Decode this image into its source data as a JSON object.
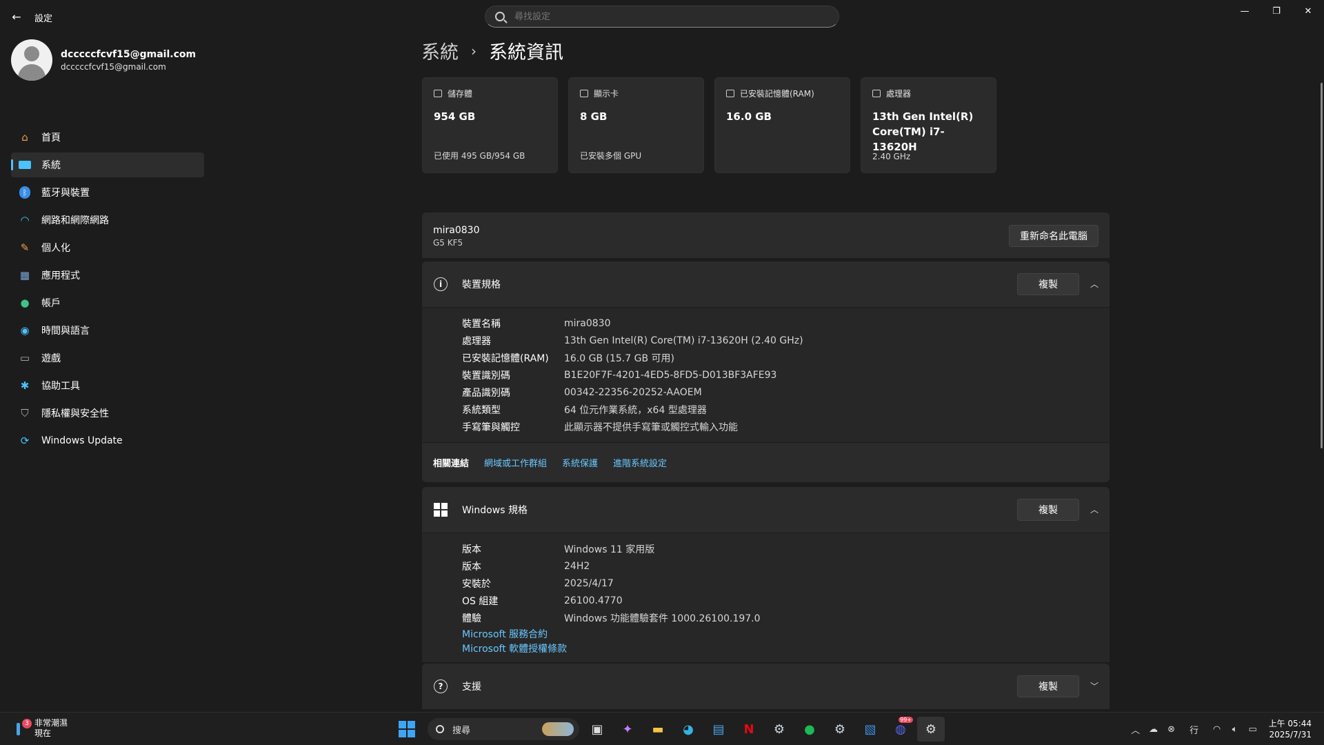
{
  "window": {
    "back_icon": "back-arrow-icon",
    "title": "設定",
    "search_placeholder": "尋找設定",
    "controls": [
      "minimize-icon",
      "restore-icon",
      "close-icon"
    ]
  },
  "profile": {
    "name": "dcccccfcvf15@gmail.com",
    "email": "dcccccfcvf15@gmail.com"
  },
  "sidebar": {
    "items": [
      {
        "label": "首頁",
        "icon": "home-icon",
        "active": false,
        "color": "#f0a050"
      },
      {
        "label": "系統",
        "icon": "system-icon",
        "active": true,
        "color": "#4cc2ff"
      },
      {
        "label": "藍牙與裝置",
        "icon": "bluetooth-icon",
        "active": false,
        "color": "#3a8ee6"
      },
      {
        "label": "網路和網際網路",
        "icon": "wifi-icon",
        "active": false,
        "color": "#4cc2ff"
      },
      {
        "label": "個人化",
        "icon": "brush-icon",
        "active": false,
        "color": "#f0a050"
      },
      {
        "label": "應用程式",
        "icon": "apps-icon",
        "active": false,
        "color": "#7aa8d8"
      },
      {
        "label": "帳戶",
        "icon": "account-icon",
        "active": false,
        "color": "#3fc28a"
      },
      {
        "label": "時間與語言",
        "icon": "globe-icon",
        "active": false,
        "color": "#4cc2ff"
      },
      {
        "label": "遊戲",
        "icon": "gamepad-icon",
        "active": false,
        "color": "#a0a0a0"
      },
      {
        "label": "協助工具",
        "icon": "accessibility-icon",
        "active": false,
        "color": "#4cc2ff"
      },
      {
        "label": "隱私權與安全性",
        "icon": "shield-icon",
        "active": false,
        "color": "#a0a0a0"
      },
      {
        "label": "Windows Update",
        "icon": "update-icon",
        "active": false,
        "color": "#4cc2ff"
      }
    ]
  },
  "breadcrumb": {
    "parent": "系統",
    "separator": "›",
    "current": "系統資訊"
  },
  "cards": [
    {
      "label": "儲存體",
      "value": "954 GB",
      "sub": "已使用 495 GB/954 GB",
      "icon": "storage-icon"
    },
    {
      "label": "顯示卡",
      "value": "8 GB",
      "sub": "已安裝多個 GPU",
      "icon": "gpu-icon"
    },
    {
      "label": "已安裝記憶體(RAM)",
      "value": "16.0 GB",
      "sub": "",
      "icon": "ram-icon"
    },
    {
      "label": "處理器",
      "value": "13th Gen Intel(R) Core(TM) i7-13620H",
      "sub": "2.40 GHz",
      "icon": "cpu-icon"
    }
  ],
  "pc": {
    "name": "mira0830",
    "model": "G5 KF5",
    "rename_label": "重新命名此電腦"
  },
  "device_specs": {
    "title": "裝置規格",
    "copy_label": "複製",
    "rows": [
      {
        "k": "裝置名稱",
        "v": "mira0830"
      },
      {
        "k": "處理器",
        "v": "13th Gen Intel(R) Core(TM) i7-13620H (2.40 GHz)"
      },
      {
        "k": "已安裝記憶體(RAM)",
        "v": "16.0 GB (15.7 GB 可用)"
      },
      {
        "k": "裝置識別碼",
        "v": "B1E20F7F-4201-4ED5-8FD5-D013BF3AFE93"
      },
      {
        "k": "產品識別碼",
        "v": "00342-22356-20252-AAOEM"
      },
      {
        "k": "系統類型",
        "v": "64 位元作業系統，x64 型處理器"
      },
      {
        "k": "手寫筆與觸控",
        "v": "此顯示器不提供手寫筆或觸控式輸入功能"
      }
    ],
    "related_label": "相關連結",
    "related_links": [
      "網域或工作群組",
      "系統保護",
      "進階系統設定"
    ]
  },
  "windows_specs": {
    "title": "Windows 規格",
    "copy_label": "複製",
    "rows": [
      {
        "k": "版本",
        "v": "Windows 11 家用版"
      },
      {
        "k": "版本",
        "v": "24H2"
      },
      {
        "k": "安裝於",
        "v": "2025/4/17"
      },
      {
        "k": "OS 組建",
        "v": "26100.4770"
      },
      {
        "k": "體驗",
        "v": "Windows 功能體驗套件 1000.26100.197.0"
      }
    ],
    "links": [
      "Microsoft 服務合約",
      "Microsoft 軟體授權條款"
    ]
  },
  "support": {
    "title": "支援",
    "copy_label": "複製"
  },
  "taskbar": {
    "weather_badge": "3",
    "weather_line1": "非常潮濕",
    "weather_line2": "現在",
    "search_label": "搜尋",
    "apps": [
      "task-view-icon",
      "copilot-icon",
      "file-explorer-icon",
      "edge-icon",
      "store-icon",
      "netflix-icon",
      "steam-icon",
      "spotify-icon",
      "steam-icon-2",
      "photos-icon",
      "discord-icon",
      "settings-icon"
    ],
    "discord_badge": "99+",
    "ime": "行",
    "time": "上午 05:44",
    "date": "2025/7/31"
  }
}
